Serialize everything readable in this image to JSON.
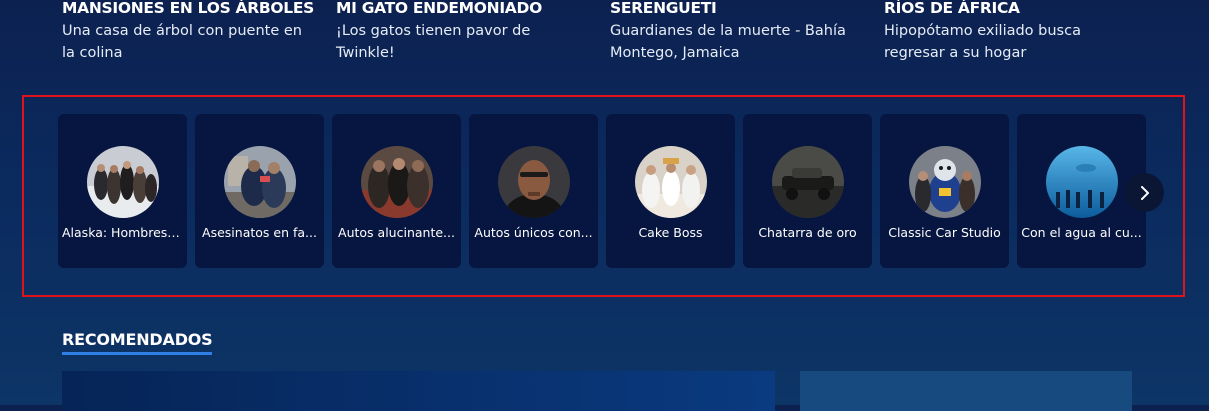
{
  "featured": [
    {
      "title": "MANSIONES EN LOS ÁRBOLES",
      "description": "Una casa de árbol con puente en la colina"
    },
    {
      "title": "MI GATO ENDEMONIADO",
      "description": "¡Los gatos tienen pavor de Twinkle!"
    },
    {
      "title": "SERENGUETI",
      "description": "Guardianes de la muerte - Bahía Montego, Jamaica"
    },
    {
      "title": "RÍOS DE ÁFRICA",
      "description": "Hipopótamo exiliado busca regresar a su hogar"
    }
  ],
  "carousel": {
    "shows": [
      {
        "label": "Alaska: Hombres ..."
      },
      {
        "label": "Asesinatos en fa..."
      },
      {
        "label": "Autos alucinante..."
      },
      {
        "label": "Autos únicos con..."
      },
      {
        "label": "Cake Boss"
      },
      {
        "label": "Chatarra de oro"
      },
      {
        "label": "Classic Car Studio"
      },
      {
        "label": "Con el agua al cu..."
      }
    ],
    "next_icon": "chevron-right-icon",
    "highlight_color": "#e0131c",
    "card_color": "#071640"
  },
  "recommended": {
    "title": "RECOMENDADOS",
    "underline_color": "#2f7fe6"
  }
}
